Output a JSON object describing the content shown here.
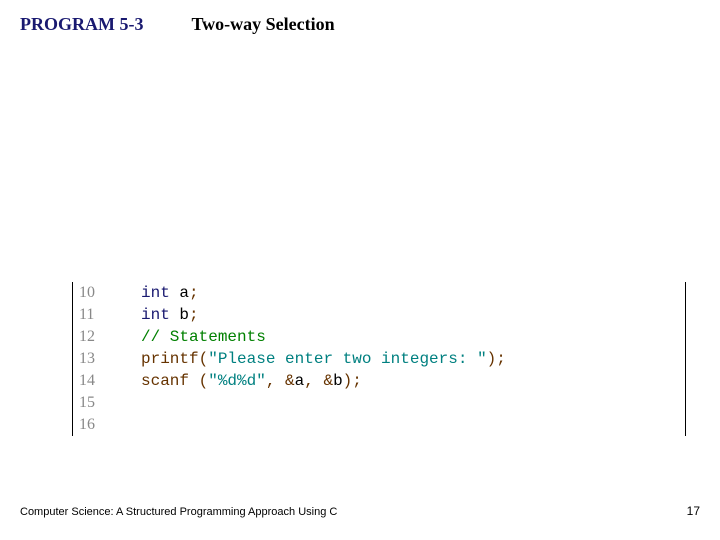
{
  "header": {
    "program_label": "PROGRAM 5-3",
    "program_title": "Two-way Selection"
  },
  "code": {
    "line_numbers": [
      "10",
      "11",
      "12",
      "13",
      "14",
      "15",
      "16"
    ],
    "lines": {
      "l10": {
        "kw": "int ",
        "id": "a",
        "semi": ";"
      },
      "l11": {
        "kw": "int ",
        "id": "b",
        "semi": ";"
      },
      "l12": "",
      "l13": {
        "comment": "// Statements"
      },
      "l14": {
        "fn": "printf",
        "open": "(",
        "str": "\"Please enter two integers: \"",
        "close": ");"
      },
      "l15": {
        "fn": "scanf ",
        "open": "(",
        "str": "\"%d%d\"",
        "comma1": ", ",
        "amp1": "&",
        "id1": "a",
        "comma2": ", ",
        "amp2": "&",
        "id2": "b",
        "close": ");"
      },
      "l16": ""
    }
  },
  "footer": {
    "text": "Computer Science: A Structured Programming Approach Using C",
    "page": "17"
  }
}
